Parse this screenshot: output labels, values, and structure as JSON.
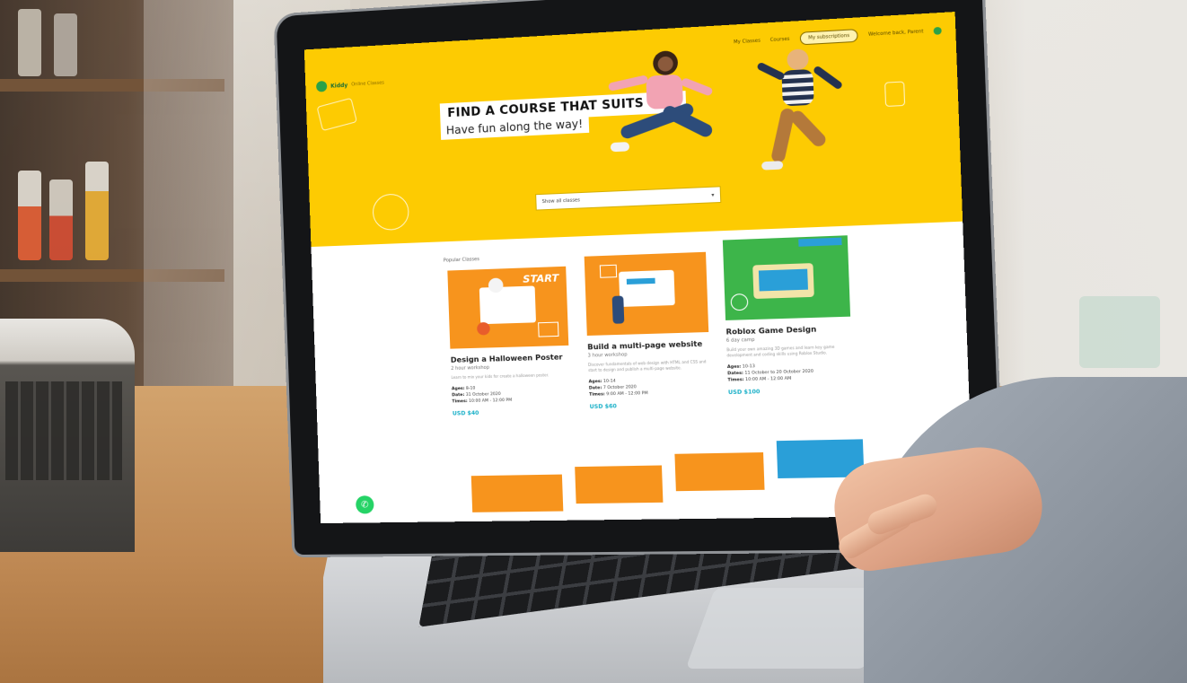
{
  "site": {
    "logo_text": "Kiddy",
    "logo_sub": "Online Classes",
    "nav": [
      "My Classes",
      "Courses",
      "My subscriptions",
      "Welcome back, Parent"
    ]
  },
  "hero": {
    "headline": "FIND A COURSE THAT SUITS YOU",
    "subline": "Have fun along the way!",
    "select_value": "Show all classes",
    "bg_color": "#fdcb02"
  },
  "section_label": "Popular Classes",
  "cards": [
    {
      "title": "Design a Halloween Poster",
      "subtitle": "2 hour workshop",
      "description": "Learn to mix your kids for create a halloween poster.",
      "ages_label": "Ages:",
      "ages": "8-10",
      "date_label": "Date:",
      "date": "31 October 2020",
      "times_label": "Times:",
      "times": "10:00 AM - 12:00 PM",
      "price": "USD $40",
      "image_color": "#f7941d",
      "image_text": "START"
    },
    {
      "title": "Build a multi-page website",
      "subtitle": "3 hour workshop",
      "description": "Discover fundamentals of web design with HTML and CSS and start to design and publish a multi-page website.",
      "ages_label": "Ages:",
      "ages": "10-14",
      "date_label": "Date:",
      "date": "7 October 2020",
      "times_label": "Times:",
      "times": "9:00 AM - 12:00 PM",
      "price": "USD $60",
      "image_color": "#f7941d"
    },
    {
      "title": "Roblox Game Design",
      "subtitle": "6 day camp",
      "description": "Build your own amazing 3D games and learn key game development and coding skills using Roblox Studio.",
      "ages_label": "Ages:",
      "ages": "10-13",
      "dates_label": "Dates:",
      "dates": "11 October to 20 October 2020",
      "times_label": "Times:",
      "times": "10:00 AM - 12:00 AM",
      "price": "USD $100",
      "image_color": "#3db54a"
    }
  ],
  "row2_colors": [
    "#f7941d",
    "#f7941d",
    "#f7941d",
    "#2a9fd8"
  ],
  "whatsapp_icon": "whatsapp-icon"
}
